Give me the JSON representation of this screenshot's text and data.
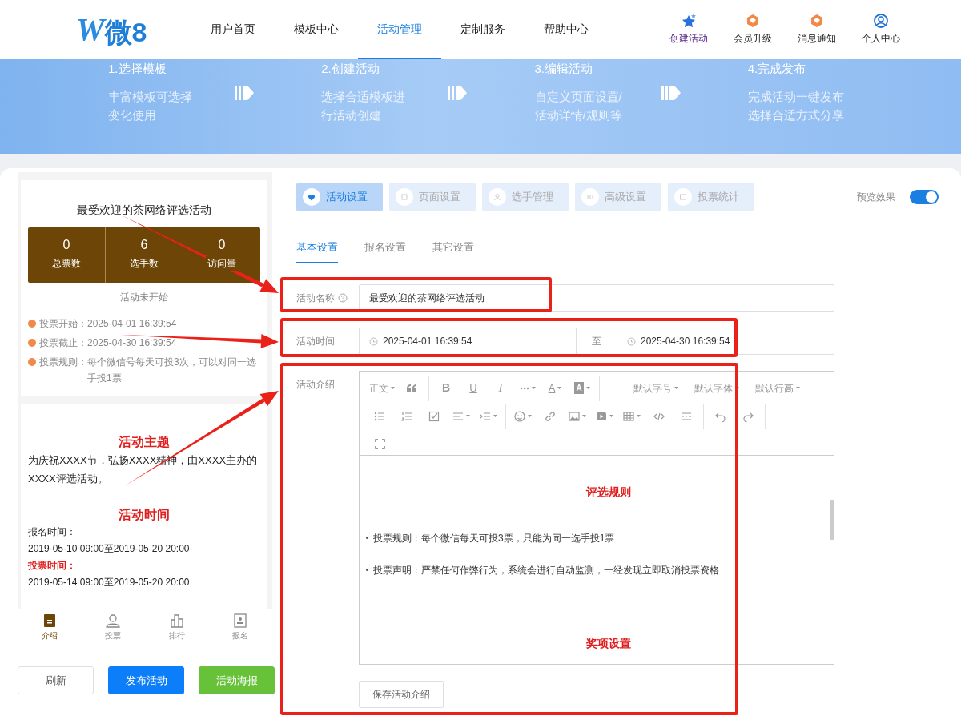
{
  "header": {
    "logo_mark": "W",
    "logo_text": "微8",
    "nav": [
      {
        "label": "用户首页",
        "selected": false
      },
      {
        "label": "模板中心",
        "selected": false
      },
      {
        "label": "活动管理",
        "selected": true
      },
      {
        "label": "定制服务",
        "selected": false
      },
      {
        "label": "帮助中心",
        "selected": false
      }
    ],
    "actions": [
      {
        "label": "创建活动",
        "kind": "create"
      },
      {
        "label": "会员升级",
        "kind": "member"
      },
      {
        "label": "消息通知",
        "kind": "notice"
      },
      {
        "label": "个人中心",
        "kind": "user"
      }
    ]
  },
  "steps": [
    {
      "title": "1.选择模板",
      "lines": [
        "丰富模板可选择",
        "变化使用"
      ]
    },
    {
      "title": "2.创建活动",
      "lines": [
        "选择合适模板进",
        "行活动创建"
      ]
    },
    {
      "title": "3.编辑活动",
      "lines": [
        "自定义页面设置/",
        "活动详情/规则等"
      ]
    },
    {
      "title": "4.完成发布",
      "lines": [
        "完成活动一键发布",
        "选择合适方式分享"
      ]
    }
  ],
  "preview": {
    "title": "最受欢迎的茶网络评选活动",
    "stats": [
      {
        "value": "0",
        "label": "总票数"
      },
      {
        "value": "6",
        "label": "选手数"
      },
      {
        "value": "0",
        "label": "访问量"
      }
    ],
    "status": "活动未开始",
    "info": [
      {
        "label": "投票开始：",
        "value": "2025-04-01 16:39:54"
      },
      {
        "label": "投票截止：",
        "value": "2025-04-30 16:39:54"
      },
      {
        "label": "投票规则：",
        "value": "每个微信号每天可投3次，可以对同一选手投1票"
      }
    ],
    "content": [
      {
        "kind": "heading",
        "text": "活动主题"
      },
      {
        "kind": "para",
        "text": "为庆祝XXXX节，弘扬XXXX精神，由XXXX主办的XXXX评选活动。"
      },
      {
        "kind": "heading",
        "text": "活动时间"
      },
      {
        "kind": "line",
        "text": "报名时间："
      },
      {
        "kind": "line",
        "text": "2019-05-10 09:00至2019-05-20 20:00"
      },
      {
        "kind": "label",
        "text": "投票时间："
      },
      {
        "kind": "line",
        "text": "2019-05-14 09:00至2019-05-20 20:00"
      }
    ],
    "tabbar": [
      {
        "label": "介绍",
        "selected": true,
        "kind": "intro"
      },
      {
        "label": "投票",
        "selected": false,
        "kind": "vote"
      },
      {
        "label": "排行",
        "selected": false,
        "kind": "rank"
      },
      {
        "label": "报名",
        "selected": false,
        "kind": "signup"
      }
    ]
  },
  "left_buttons": [
    {
      "label": "刷新",
      "kind": "refresh"
    },
    {
      "label": "发布活动",
      "kind": "publish"
    },
    {
      "label": "活动海报",
      "kind": "poster"
    }
  ],
  "setting_tabs": [
    {
      "label": "活动设置",
      "selected": true
    },
    {
      "label": "页面设置",
      "selected": false
    },
    {
      "label": "选手管理",
      "selected": false
    },
    {
      "label": "高级设置",
      "selected": false
    },
    {
      "label": "投票统计",
      "selected": false
    }
  ],
  "preview_toggle": {
    "label": "预览效果",
    "on": true
  },
  "sub_tabs": [
    {
      "label": "基本设置",
      "selected": true
    },
    {
      "label": "报名设置",
      "selected": false
    },
    {
      "label": "其它设置",
      "selected": false
    }
  ],
  "form": {
    "name": {
      "label": "活动名称",
      "value": "最受欢迎的茶网络评选活动"
    },
    "time": {
      "label": "活动时间",
      "start": "2025-04-01 16:39:54",
      "separator": "至",
      "end": "2025-04-30 16:39:54"
    },
    "intro": {
      "label": "活动介绍",
      "block_menu": "正文",
      "format_buttons": [
        "B",
        "U",
        "I"
      ],
      "color_buttons": [
        "A",
        "A"
      ],
      "font_menus": [
        "默认字号",
        "默认字体",
        "默认行高"
      ],
      "content": [
        {
          "kind": "heading",
          "text": "评选规则"
        },
        {
          "kind": "bullet",
          "text": "投票规则：每个微信每天可投3票，只能为同一选手投1票"
        },
        {
          "kind": "bullet",
          "text": "投票声明：严禁任何作弊行为，系统会进行自动监测，一经发现立即取消投票资格"
        },
        {
          "kind": "heading",
          "text": "奖项设置"
        }
      ],
      "save": "保存活动介绍"
    }
  }
}
